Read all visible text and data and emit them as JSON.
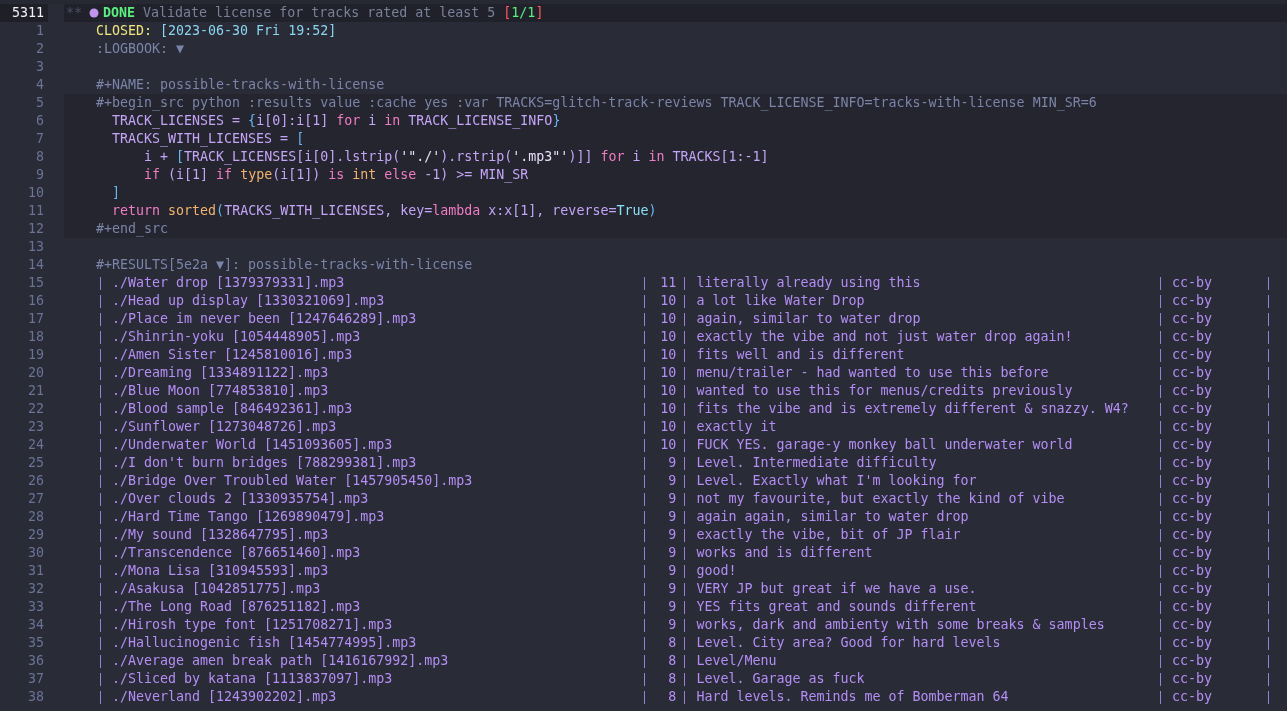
{
  "heading": {
    "number": "5311",
    "current": true,
    "stars": "**",
    "todo": "DONE",
    "title": "Validate license for tracks rated at least 5",
    "cookie": [
      {
        "text": "[",
        "kind": "cookie_bracket"
      },
      {
        "text": "1/1",
        "kind": "cookie_value"
      },
      {
        "text": "]",
        "kind": "cookie_bracket"
      }
    ]
  },
  "sections": [
    {
      "kind": "plain",
      "lines": [
        {
          "number": "1",
          "kind": "code",
          "tokens": [
            {
              "text": "CLOSED: ",
              "kind": "special"
            },
            {
              "text": "[2023-06-30 Fri 19:52]",
              "kind": "date"
            }
          ]
        },
        {
          "number": "2",
          "kind": "code",
          "tokens": [
            {
              "text": ":LOGBOOK: ▼",
              "kind": "meta"
            }
          ]
        },
        {
          "number": "3",
          "kind": "blank"
        },
        {
          "number": "4",
          "kind": "code",
          "tokens": [
            {
              "text": "#+NAME: possible-tracks-with-license",
              "kind": "meta"
            }
          ]
        }
      ]
    },
    {
      "kind": "src_block",
      "lines": [
        {
          "number": "5",
          "kind": "code",
          "tokens": [
            {
              "text": "#+begin_src python :results value :cache yes :var TRACKS=glitch-track-reviews TRACK_LICENSE_INFO=tracks-with-license MIN_SR=6",
              "kind": "meta"
            }
          ]
        },
        {
          "number": "6",
          "kind": "code",
          "tokens": [
            {
              "text": "  TRACK_LICENSES = ",
              "kind": "plain"
            },
            {
              "text": "{",
              "kind": "bracket"
            },
            {
              "text": "i[0]:i[1] ",
              "kind": "plain"
            },
            {
              "text": "for",
              "kind": "keyword"
            },
            {
              "text": " i ",
              "kind": "plain"
            },
            {
              "text": "in",
              "kind": "keyword"
            },
            {
              "text": " TRACK_LICENSE_INFO",
              "kind": "plain"
            },
            {
              "text": "}",
              "kind": "bracket"
            }
          ]
        },
        {
          "number": "7",
          "kind": "code",
          "tokens": [
            {
              "text": "  TRACKS_WITH_LICENSES = ",
              "kind": "plain"
            },
            {
              "text": "[",
              "kind": "bracket"
            }
          ]
        },
        {
          "number": "8",
          "kind": "code",
          "tokens": [
            {
              "text": "      i + ",
              "kind": "plain"
            },
            {
              "text": "[",
              "kind": "bracket"
            },
            {
              "text": "TRACK_LICENSES[i[0].lstrip(",
              "kind": "plain"
            },
            {
              "text": "'\"./'",
              "kind": "string"
            },
            {
              "text": ").rstrip(",
              "kind": "plain"
            },
            {
              "text": "'.mp3\"'",
              "kind": "string"
            },
            {
              "text": ")]] ",
              "kind": "plain"
            },
            {
              "text": "for",
              "kind": "keyword"
            },
            {
              "text": " i ",
              "kind": "plain"
            },
            {
              "text": "in",
              "kind": "keyword"
            },
            {
              "text": " TRACKS[1:-1]",
              "kind": "plain"
            }
          ]
        },
        {
          "number": "9",
          "kind": "code",
          "tokens": [
            {
              "text": "      if",
              "kind": "keyword"
            },
            {
              "text": " (i[1] ",
              "kind": "plain"
            },
            {
              "text": "if ",
              "kind": "keyword"
            },
            {
              "text": "type",
              "kind": "builtin"
            },
            {
              "text": "(i[1]) ",
              "kind": "plain"
            },
            {
              "text": "is ",
              "kind": "keyword"
            },
            {
              "text": "int ",
              "kind": "builtin"
            },
            {
              "text": "else",
              "kind": "keyword"
            },
            {
              "text": " -1) >= MIN_SR",
              "kind": "plain"
            }
          ]
        },
        {
          "number": "10",
          "kind": "code",
          "tokens": [
            {
              "text": "  ]",
              "kind": "bracket"
            }
          ]
        },
        {
          "number": "11",
          "kind": "code",
          "tokens": [
            {
              "text": "  return ",
              "kind": "keyword"
            },
            {
              "text": "sorted",
              "kind": "builtin"
            },
            {
              "text": "(",
              "kind": "bracket"
            },
            {
              "text": "TRACKS_WITH_LICENSES, key=",
              "kind": "plain"
            },
            {
              "text": "lambda",
              "kind": "keyword"
            },
            {
              "text": " x:x[1], reverse=",
              "kind": "plain"
            },
            {
              "text": "True",
              "kind": "constant"
            },
            {
              "text": ")",
              "kind": "bracket"
            }
          ]
        },
        {
          "number": "12",
          "kind": "code",
          "tokens": [
            {
              "text": "#+end_src",
              "kind": "meta"
            }
          ]
        }
      ]
    },
    {
      "kind": "plain",
      "lines": [
        {
          "number": "13",
          "kind": "blank"
        },
        {
          "number": "14",
          "kind": "code",
          "tokens": [
            {
              "text": "#+RESULTS[5e2a ▼]: possible-tracks-with-license",
              "kind": "meta"
            }
          ]
        },
        {
          "number": "15",
          "kind": "table_row",
          "cells": [
            "./Water drop [1379379331].mp3",
            "11",
            "literally already using this",
            "cc-by"
          ]
        },
        {
          "number": "16",
          "kind": "table_row",
          "cells": [
            "./Head up display [1330321069].mp3",
            "10",
            "a lot like Water Drop",
            "cc-by"
          ]
        },
        {
          "number": "17",
          "kind": "table_row",
          "cells": [
            "./Place im never been [1247646289].mp3",
            "10",
            "again, similar to water drop",
            "cc-by"
          ]
        },
        {
          "number": "18",
          "kind": "table_row",
          "cells": [
            "./Shinrin-yoku [1054448905].mp3",
            "10",
            "exactly the vibe and not just water drop again!",
            "cc-by"
          ]
        },
        {
          "number": "19",
          "kind": "table_row",
          "cells": [
            "./Amen Sister [1245810016].mp3",
            "10",
            "fits well and is different",
            "cc-by"
          ]
        },
        {
          "number": "20",
          "kind": "table_row",
          "cells": [
            "./Dreaming [1334891122].mp3",
            "10",
            "menu/trailer - had wanted to use this before",
            "cc-by"
          ]
        },
        {
          "number": "21",
          "kind": "table_row",
          "cells": [
            "./Blue Moon [774853810].mp3",
            "10",
            "wanted to use this for menus/credits previously",
            "cc-by"
          ]
        },
        {
          "number": "22",
          "kind": "table_row",
          "cells": [
            "./Blood sample [846492361].mp3",
            "10",
            "fits the vibe and is extremely different & snazzy. W4?",
            "cc-by"
          ]
        },
        {
          "number": "23",
          "kind": "table_row",
          "cells": [
            "./Sunflower [1273048726].mp3",
            "10",
            "exactly it",
            "cc-by"
          ]
        },
        {
          "number": "24",
          "kind": "table_row",
          "cells": [
            "./Underwater World [1451093605].mp3",
            "10",
            "FUCK YES. garage-y monkey ball underwater world",
            "cc-by"
          ]
        },
        {
          "number": "25",
          "kind": "table_row",
          "cells": [
            "./I don't burn bridges [788299381].mp3",
            "9",
            "Level. Intermediate difficulty",
            "cc-by"
          ]
        },
        {
          "number": "26",
          "kind": "table_row",
          "cells": [
            "./Bridge Over Troubled Water [1457905450].mp3",
            "9",
            "Level. Exactly what I'm looking for",
            "cc-by"
          ]
        },
        {
          "number": "27",
          "kind": "table_row",
          "cells": [
            "./Over clouds 2 [1330935754].mp3",
            "9",
            "not my favourite, but exactly the kind of vibe",
            "cc-by"
          ]
        },
        {
          "number": "28",
          "kind": "table_row",
          "cells": [
            "./Hard Time Tango [1269890479].mp3",
            "9",
            "again again, similar to water drop",
            "cc-by"
          ]
        },
        {
          "number": "29",
          "kind": "table_row",
          "cells": [
            "./My sound [1328647795].mp3",
            "9",
            "exactly the vibe, bit of JP flair",
            "cc-by"
          ]
        },
        {
          "number": "30",
          "kind": "table_row",
          "cells": [
            "./Transcendence [876651460].mp3",
            "9",
            "works and is different",
            "cc-by"
          ]
        },
        {
          "number": "31",
          "kind": "table_row",
          "cells": [
            "./Mona Lisa [310945593].mp3",
            "9",
            "good!",
            "cc-by"
          ]
        },
        {
          "number": "32",
          "kind": "table_row",
          "cells": [
            "./Asakusa [1042851775].mp3",
            "9",
            "VERY JP but great if we have a use.",
            "cc-by"
          ]
        },
        {
          "number": "33",
          "kind": "table_row",
          "cells": [
            "./The Long Road [876251182].mp3",
            "9",
            "YES fits great and sounds different",
            "cc-by"
          ]
        },
        {
          "number": "34",
          "kind": "table_row",
          "cells": [
            "./Hirosh type font [1251708271].mp3",
            "9",
            "works, dark and ambienty with some breaks & samples",
            "cc-by"
          ]
        },
        {
          "number": "35",
          "kind": "table_row",
          "cells": [
            "./Hallucinogenic fish [1454774995].mp3",
            "8",
            "Level. City area? Good for hard levels",
            "cc-by"
          ]
        },
        {
          "number": "36",
          "kind": "table_row",
          "cells": [
            "./Average amen break path [1416167992].mp3",
            "8",
            "Level/Menu",
            "cc-by"
          ]
        },
        {
          "number": "37",
          "kind": "table_row",
          "cells": [
            "./Sliced by katana [1113837097].mp3",
            "8",
            "Level. Garage as fuck",
            "cc-by"
          ]
        },
        {
          "number": "38",
          "kind": "table_row",
          "cells": [
            "./Neverland [1243902202].mp3",
            "8",
            "Hard levels. Reminds me of Bomberman 64",
            "cc-by"
          ]
        }
      ]
    }
  ]
}
